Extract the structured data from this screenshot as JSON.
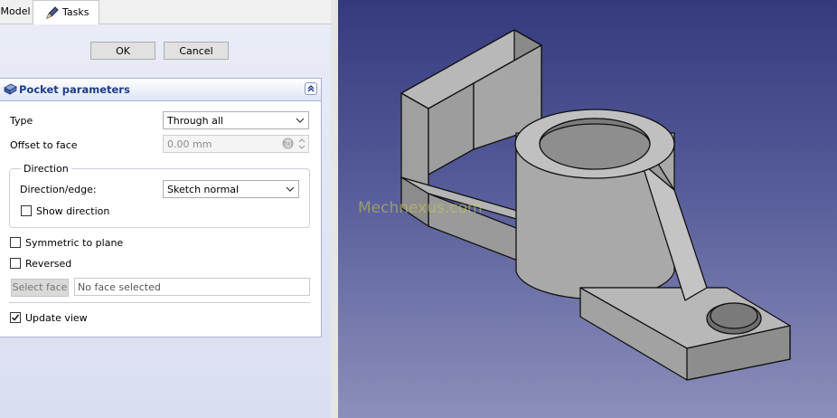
{
  "tabs": {
    "model_label": "Model",
    "tasks_label": "Tasks"
  },
  "dialog": {
    "ok_label": "OK",
    "cancel_label": "Cancel"
  },
  "pocket": {
    "title": "Pocket parameters",
    "type_label": "Type",
    "type_value": "Through all",
    "offset_label": "Offset to face",
    "offset_value": "0.00 mm",
    "direction_group_title": "Direction",
    "direction_edge_label": "Direction/edge:",
    "direction_edge_value": "Sketch normal",
    "show_direction_label": "Show direction",
    "show_direction_checked": false,
    "symmetric_label": "Symmetric to plane",
    "symmetric_checked": false,
    "reversed_label": "Reversed",
    "reversed_checked": false,
    "select_face_label": "Select face",
    "face_field_value": "No face selected",
    "update_view_label": "Update view",
    "update_view_checked": true
  },
  "viewport": {
    "watermark": "Mechnexus.com"
  },
  "colors": {
    "viewport_top": "#343a7e",
    "viewport_bottom": "#8c8fbb",
    "header_text": "#1e3c8a",
    "part_face": "#a9a9a9"
  }
}
